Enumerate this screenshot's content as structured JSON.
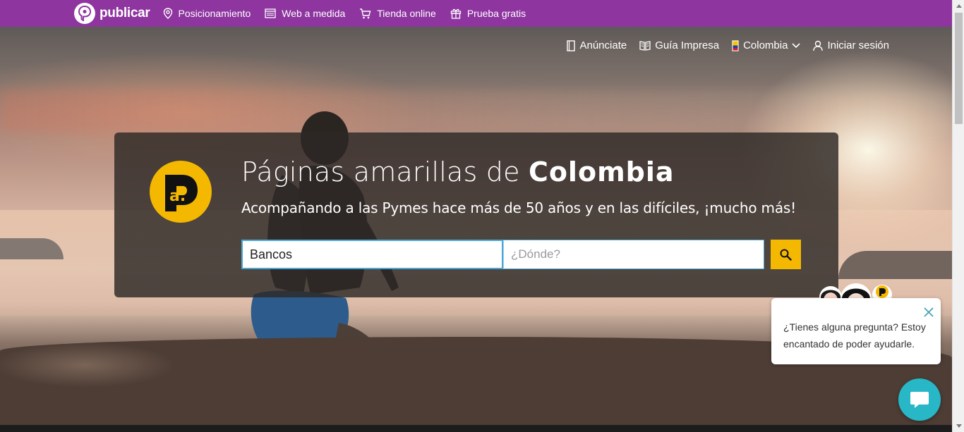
{
  "topbar": {
    "brand": "publicar",
    "nav": [
      {
        "label": "Posicionamiento",
        "icon": "map-pin-icon"
      },
      {
        "label": "Web a medida",
        "icon": "web-layout-icon"
      },
      {
        "label": "Tienda online",
        "icon": "cart-icon"
      },
      {
        "label": "Prueba gratis",
        "icon": "gift-icon"
      }
    ],
    "color": "#8e35a0"
  },
  "utility_nav": {
    "advertise": "Anúnciate",
    "print_guide": "Guía Impresa",
    "country": "Colombia",
    "login": "Iniciar sesión"
  },
  "hero": {
    "brand_letter": "a.",
    "title_light": "Páginas amarillas de ",
    "title_bold": "Colombia",
    "subtitle": "Acompañando a las Pymes hace más de 50 años y en las difíciles, ¡mucho más!",
    "search": {
      "what_value": "Bancos",
      "where_placeholder": "¿Dónde?",
      "button_color": "#f5b800"
    }
  },
  "chat": {
    "message": "¿Tienes alguna pregunta? Estoy encantado de poder ayudarle.",
    "avatar_brand": "publicar",
    "launcher_color": "#27b7c6"
  }
}
